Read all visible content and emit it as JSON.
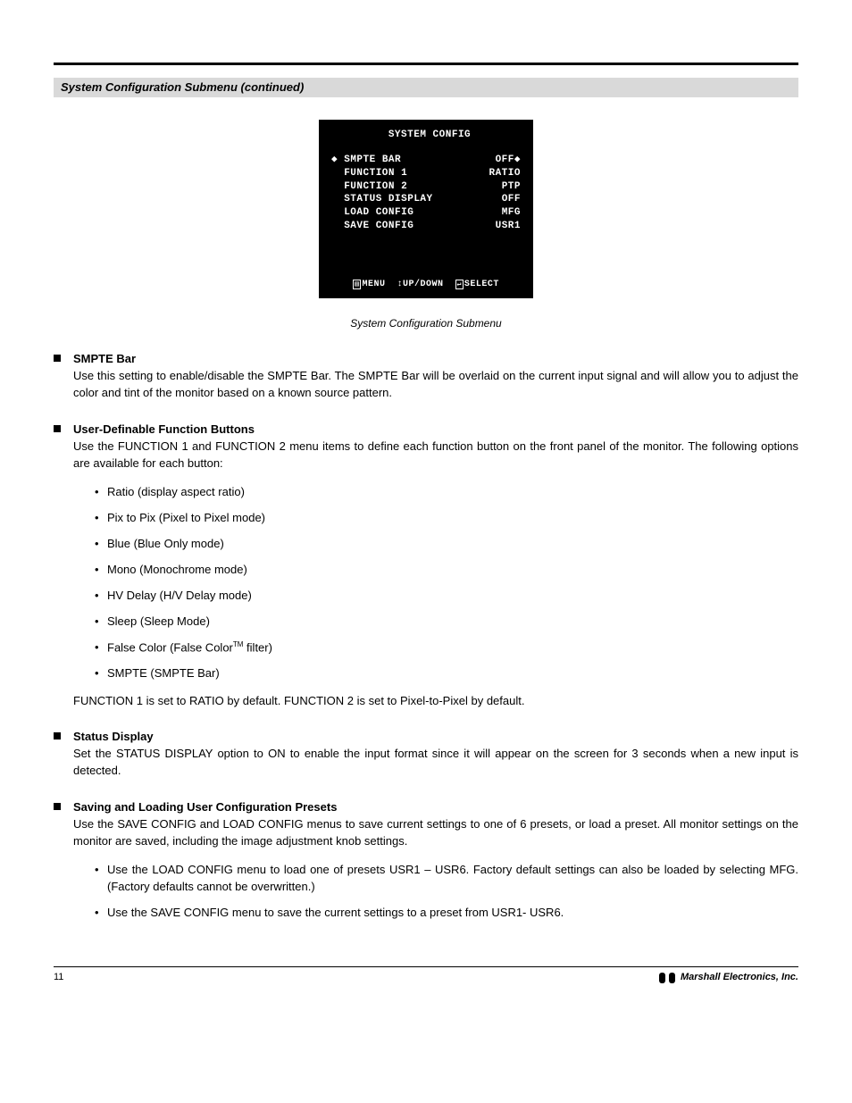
{
  "grey_bar_title": "System Configuration Submenu (continued)",
  "osd": {
    "title": "SYSTEM CONFIG",
    "rows": [
      {
        "left": "◆ SMPTE BAR",
        "right": "OFF◆"
      },
      {
        "left": "  FUNCTION 1",
        "right": "RATIO"
      },
      {
        "left": "  FUNCTION 2",
        "right": "PTP"
      },
      {
        "left": "  STATUS DISPLAY",
        "right": "OFF"
      },
      {
        "left": "  LOAD CONFIG",
        "right": "MFG"
      },
      {
        "left": "  SAVE CONFIG",
        "right": "USR1"
      }
    ],
    "foot_menu": "MENU",
    "foot_updown": "↕UP/DOWN",
    "foot_select": "SELECT"
  },
  "caption": "System Configuration Submenu",
  "bullets": [
    {
      "lead": "SMPTE Bar",
      "body": "Use this setting to enable/disable the SMPTE Bar. The SMPTE Bar will be overlaid on the current input signal and will allow you to adjust the color and tint of the monitor based on a known source pattern."
    },
    {
      "lead": "User-Definable Function Buttons",
      "body": "Use the FUNCTION 1 and FUNCTION 2 menu items to define each function button on the front panel of the monitor. The following options are available for each button:",
      "inner": [
        {
          "text": "Ratio (display aspect ratio)"
        },
        {
          "text": "Pix to Pix (Pixel to Pixel mode)"
        },
        {
          "text": "Blue (Blue Only mode)"
        },
        {
          "text": "Mono (Monochrome mode)"
        },
        {
          "text": "HV Delay (H/V Delay mode)"
        },
        {
          "text": "Sleep (Sleep Mode)"
        },
        {
          "text": "False Color (False Color filter)",
          "tm": true
        },
        {
          "text": "SMPTE (SMPTE Bar)"
        }
      ],
      "tail": "FUNCTION 1 is set to RATIO by default. FUNCTION 2 is set to Pixel-to-Pixel by default."
    },
    {
      "lead": "Status Display",
      "body": "Set the STATUS DISPLAY option to ON to enable the input format since it will appear on the screen for 3 seconds when a new input is detected."
    },
    {
      "lead": "Saving and Loading User Configuration Presets",
      "body": "Use the SAVE CONFIG and LOAD CONFIG menus to save current settings to one of 6 presets, or load a preset. All monitor settings on the monitor are saved, including the image adjustment knob settings.",
      "inner2": [
        {
          "text": "Use the LOAD CONFIG menu to load one of presets USR1 – USR6. Factory default settings can also be loaded by selecting MFG. (Factory defaults cannot be overwritten.)"
        },
        {
          "text": "Use the SAVE CONFIG menu to save the current settings to a preset from USR1- USR6."
        }
      ]
    }
  ],
  "footer": {
    "page": "11",
    "brand": "Marshall Electronics, Inc."
  }
}
